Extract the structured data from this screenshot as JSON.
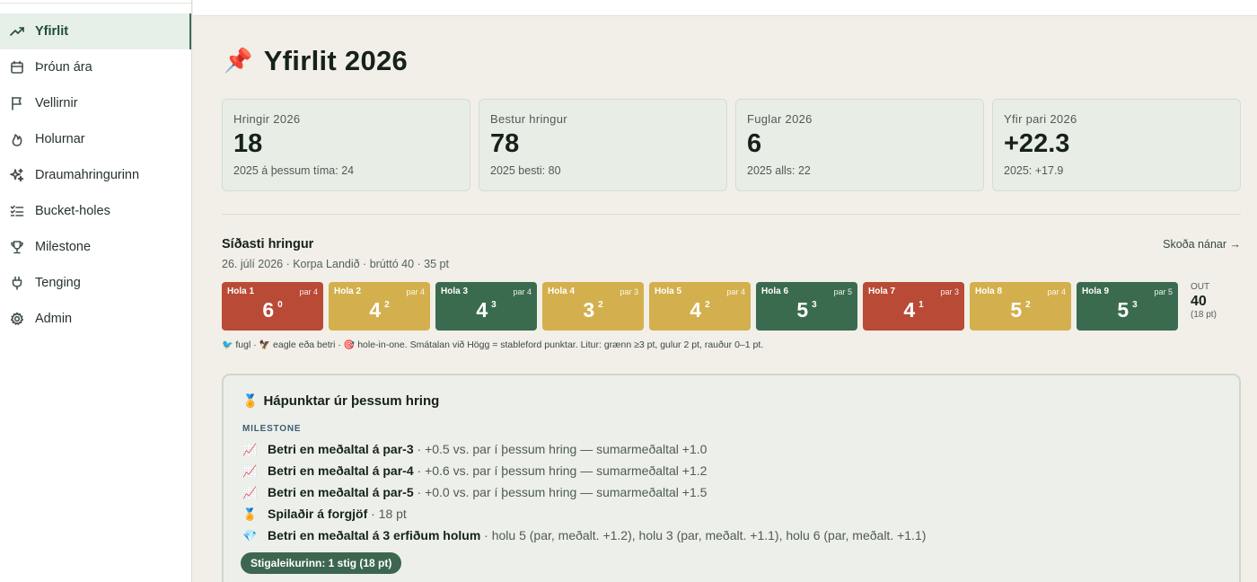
{
  "nav": [
    {
      "label": "Yfirlit",
      "icon": "trend-up-icon",
      "active": true
    },
    {
      "label": "Þróun ára",
      "icon": "calendar-icon",
      "active": false
    },
    {
      "label": "Vellirnir",
      "icon": "flag-icon",
      "active": false
    },
    {
      "label": "Holurnar",
      "icon": "flame-icon",
      "active": false
    },
    {
      "label": "Draumahringurinn",
      "icon": "sparkles-icon",
      "active": false
    },
    {
      "label": "Bucket-holes",
      "icon": "checklist-icon",
      "active": false
    },
    {
      "label": "Milestone",
      "icon": "trophy-icon",
      "active": false
    },
    {
      "label": "Tenging",
      "icon": "plug-icon",
      "active": false
    },
    {
      "label": "Admin",
      "icon": "gear-icon",
      "active": false
    }
  ],
  "page": {
    "title": "Yfirlit 2026",
    "title_icon": "📌"
  },
  "stats": [
    {
      "label": "Hringir 2026",
      "value": "18",
      "sub": "2025 á þessum tíma: 24"
    },
    {
      "label": "Bestur hringur",
      "value": "78",
      "sub": "2025 besti: 80"
    },
    {
      "label": "Fuglar 2026",
      "value": "6",
      "sub": "2025 alls: 22"
    },
    {
      "label": "Yfir pari 2026",
      "value": "+22.3",
      "sub": "2025: +17.9"
    }
  ],
  "last_round": {
    "title": "Síðasti hringur",
    "subtitle": "26. júlí 2026 · Korpa Landið · brúttó 40 · 35 pt",
    "details_link": "Skoða nánar →",
    "holes": [
      {
        "name": "Hola 1",
        "par": "par 4",
        "strokes": "6",
        "points": "0",
        "color": "red"
      },
      {
        "name": "Hola 2",
        "par": "par 4",
        "strokes": "4",
        "points": "2",
        "color": "yellow"
      },
      {
        "name": "Hola 3",
        "par": "par 4",
        "strokes": "4",
        "points": "3",
        "color": "green"
      },
      {
        "name": "Hola 4",
        "par": "par 3",
        "strokes": "3",
        "points": "2",
        "color": "yellow"
      },
      {
        "name": "Hola 5",
        "par": "par 4",
        "strokes": "4",
        "points": "2",
        "color": "yellow"
      },
      {
        "name": "Hola 6",
        "par": "par 5",
        "strokes": "5",
        "points": "3",
        "color": "green"
      },
      {
        "name": "Hola 7",
        "par": "par 3",
        "strokes": "4",
        "points": "1",
        "color": "red"
      },
      {
        "name": "Hola 8",
        "par": "par 4",
        "strokes": "5",
        "points": "2",
        "color": "yellow"
      },
      {
        "name": "Hola 9",
        "par": "par 5",
        "strokes": "5",
        "points": "3",
        "color": "green"
      }
    ],
    "out": {
      "label": "OUT",
      "value": "40",
      "sub": "(18 pt)"
    },
    "legend": {
      "bird_icon": "🐦",
      "bird_text": "fugl ·",
      "eagle_icon": "🦅",
      "eagle_text": "eagle eða betri ·",
      "hio_icon": "🎯",
      "hio_text": "hole-in-one. Smátalan við Högg = stableford punktar. Litur: grænn ≥3 pt, gulur 2 pt, rauður 0–1 pt."
    }
  },
  "highlights": {
    "icon": "🏅",
    "title": "Hápunktar úr þessum hring",
    "section": "MILESTONE",
    "rows": [
      {
        "icon": "📈",
        "bold": "Betri en meðaltal á par-3",
        "rest": " · +0.5 vs. par í þessum hring — sumarmeðaltal +1.0"
      },
      {
        "icon": "📈",
        "bold": "Betri en meðaltal á par-4",
        "rest": " · +0.6 vs. par í þessum hring — sumarmeðaltal +1.2"
      },
      {
        "icon": "📈",
        "bold": "Betri en meðaltal á par-5",
        "rest": " · +0.0 vs. par í þessum hring — sumarmeðaltal +1.5"
      },
      {
        "icon": "🏅",
        "bold": "Spilaðir á forgjöf",
        "rest": " · 18 pt"
      },
      {
        "icon": "💎",
        "bold": "Betri en meðaltal á 3 erfiðum holum",
        "rest": " · holu 5 (par, meðalt. +1.2), holu 3 (par, meðalt. +1.1), holu 6 (par, meðalt. +1.1)"
      }
    ],
    "badge": "Stigaleikurinn: 1 stig (18 pt)"
  }
}
